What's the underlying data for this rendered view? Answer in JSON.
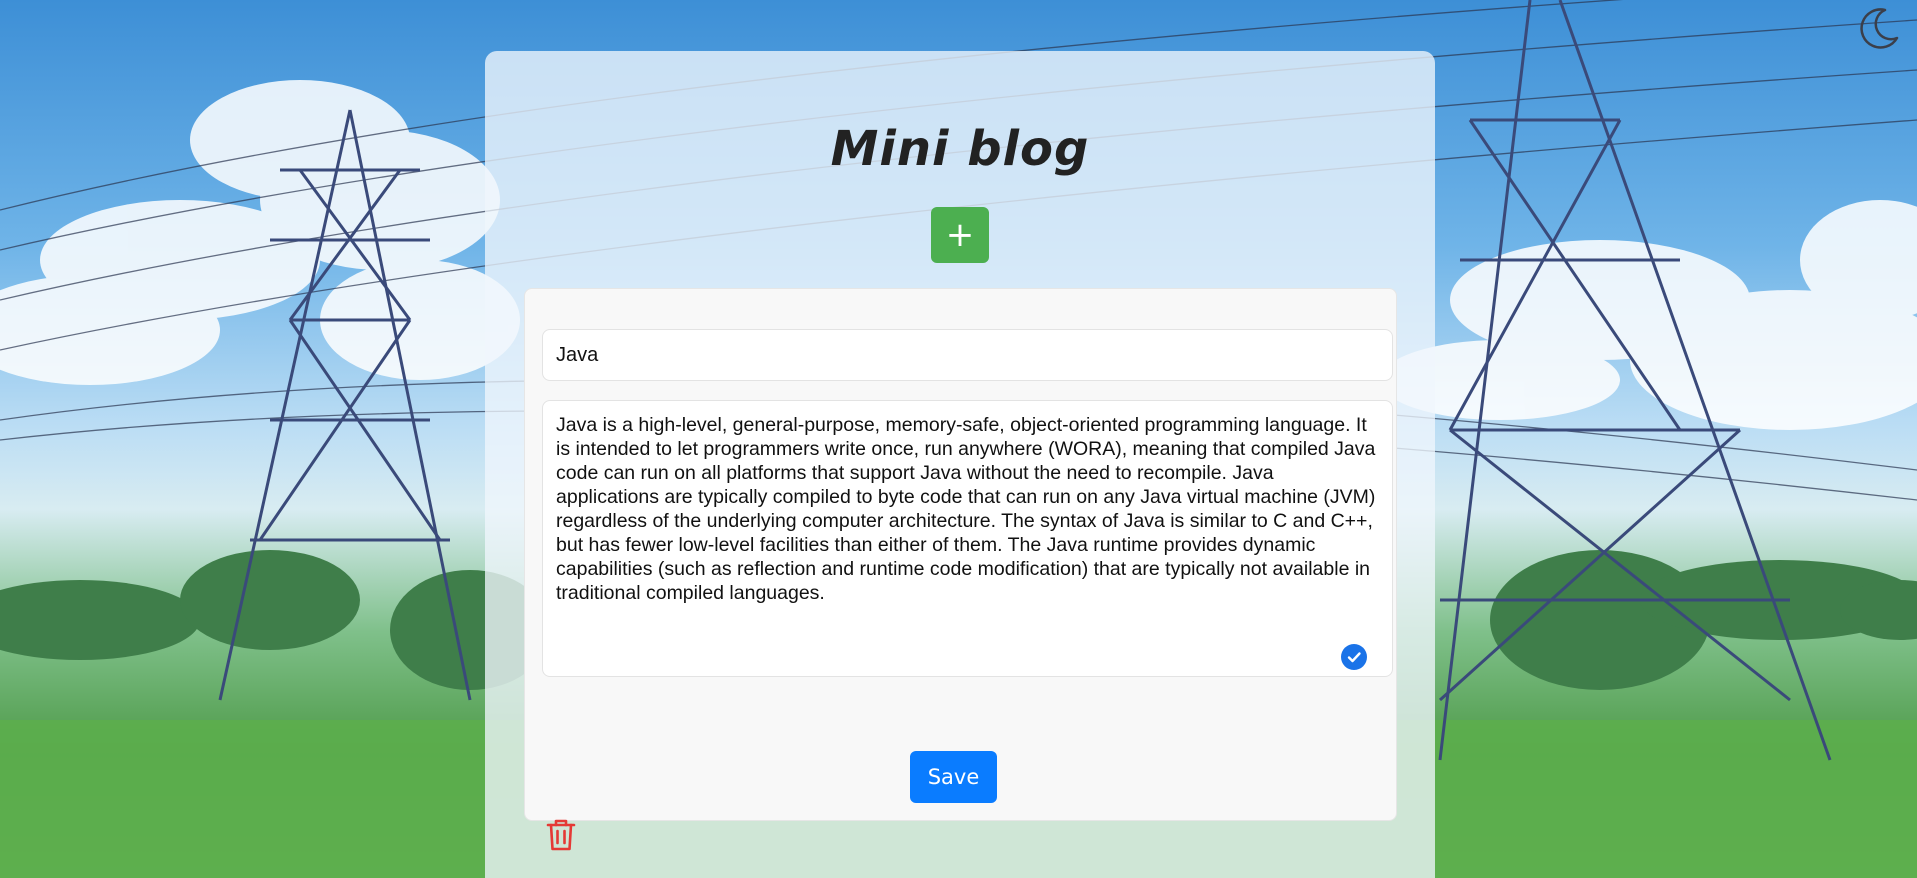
{
  "app": {
    "title": "Mini blog",
    "add_label": "+"
  },
  "post": {
    "title": "Java",
    "body": "Java is a high-level, general-purpose, memory-safe, object-oriented programming language. It is intended to let programmers write once, run anywhere (WORA), meaning that compiled Java code can run on all platforms that support Java without the need to recompile. Java applications are typically compiled to byte code that can run on any Java virtual machine (JVM) regardless of the underlying computer architecture. The syntax of Java is similar to C and C++, but has fewer low-level facilities than either of them. The Java runtime provides dynamic capabilities (such as reflection and runtime code modification) that are typically not available in traditional compiled languages.",
    "save_label": "Save"
  },
  "icons": {
    "theme_toggle": "moon-icon",
    "spell_check": "check-icon",
    "delete": "trash-icon"
  },
  "colors": {
    "add_button": "#4caf50",
    "save_button": "#0a7cff",
    "delete_icon": "#e53935",
    "check_badge": "#1a73e8"
  }
}
